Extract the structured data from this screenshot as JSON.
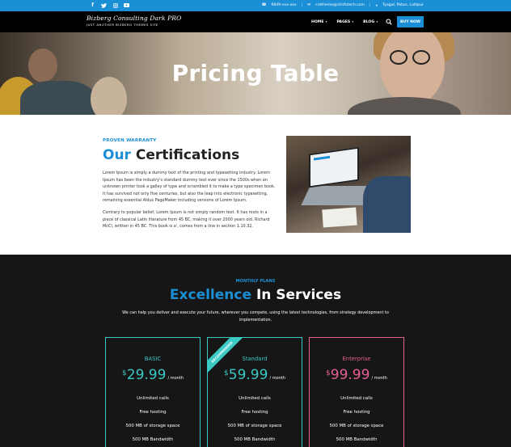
{
  "topbar": {
    "social": [
      "facebook-icon",
      "twitter-icon",
      "instagram-icon",
      "youtube-icon"
    ],
    "phone": "9849-xxx-xxx",
    "email": "cretheme@ctinfotech.com",
    "location": "Tyagal, Patan, Lalitpur"
  },
  "brand": {
    "title": "Bizberg Consulting Dark PRO",
    "tagline": "JUST ANOTHER BIZBERG THEMES SITE"
  },
  "menu": {
    "home": "HOME",
    "pages": "PAGES",
    "blog": "BLOG",
    "buy_now": "BUY NOW"
  },
  "hero": {
    "title": "Pricing Table"
  },
  "certifications": {
    "eyebrow": "PROVEN WARRANTY",
    "title_accent": "Our",
    "title_rest": "Certifications",
    "paragraph1": "Lorem Ipsum is simply a dummy text of the printing and typesetting industry. Lorem Ipsum has been the industry's standard dummy text ever since the 1500s when an unknown printer took a galley of type and scrambled it to make a type specimen book. It has survived not only five centuries, but also the leap into electronic typesetting, remaining essential Aldus PageMaker including versions of Lorem Ipsum.",
    "paragraph2": "Contrary to popular belief, Lorem Ipsum is not simply random text. It has roots in a piece of classical Latin literature from 45 BC, making it over 2000 years old. Richard McCl, written in 45 BC. This book is a', comes from a line in section 1.10.32."
  },
  "services": {
    "eyebrow": "MONTHLY PLANS",
    "title_accent": "Excellence",
    "title_rest": "In Services",
    "subtitle": "We can help you deliver and execute your future, wherever you compete, using the latest technologies, from strategy development to implementation.",
    "plans": [
      {
        "name": "BASIC",
        "currency": "$",
        "price": "29.99",
        "period": "/ month",
        "features": [
          "Unlimited calls",
          "Free hosting",
          "500 MB of storage space",
          "500 MB Bandwidth"
        ],
        "color": "#3ac9c4"
      },
      {
        "name": "Standard",
        "ribbon": "RECOMMENDED",
        "currency": "$",
        "price": "59.99",
        "period": "/ month",
        "features": [
          "Unlimited calls",
          "Free hosting",
          "500 MB of storage space",
          "500 MB Bandwidth"
        ],
        "color": "#3ac9c4"
      },
      {
        "name": "Enterprise",
        "currency": "$",
        "price": "99.99",
        "period": "/ month",
        "features": [
          "Unlimited calls",
          "Free hosting",
          "500 MB of storage space",
          "500 MB Bandwidth"
        ],
        "color": "#e65f97"
      }
    ]
  },
  "colors": {
    "accent": "#1b8fd6",
    "teal": "#3ac9c4",
    "pink": "#e65f97",
    "dark": "#161616"
  }
}
